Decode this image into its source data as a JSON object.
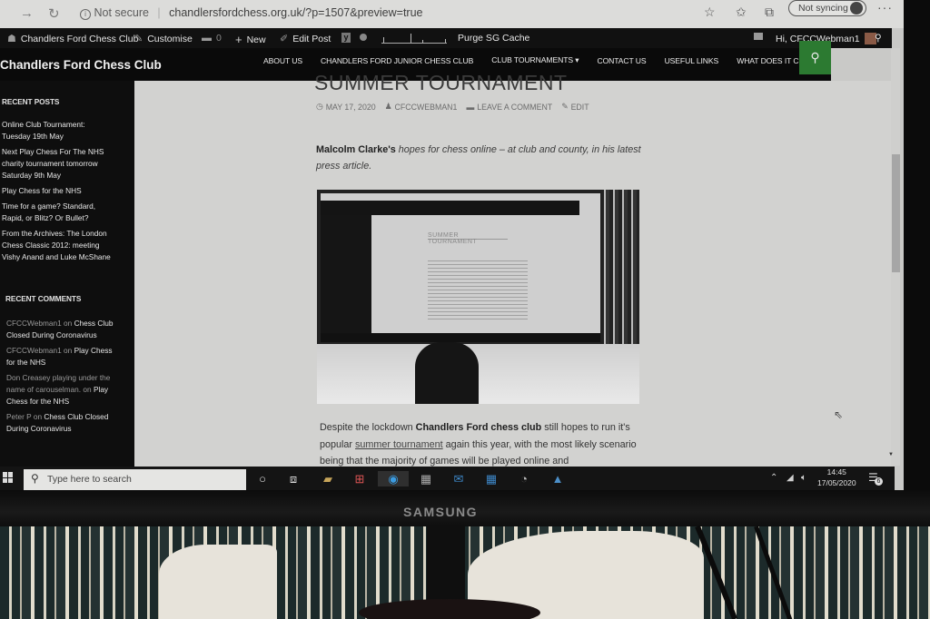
{
  "browser": {
    "back_icon": "→",
    "refresh_icon": "↻",
    "security_label": "Not secure",
    "url": "chandlersfordchess.org.uk/?p=1507&preview=true",
    "sync_label": "Not syncing",
    "more_icon": "···"
  },
  "adminbar": {
    "site_name": "Chandlers Ford Chess Club",
    "customise": "Customise",
    "comments_count": "0",
    "new": "New",
    "edit_post": "Edit Post",
    "purge_cache": "Purge SG Cache",
    "greeting": "Hi, CFCCWebman1"
  },
  "site": {
    "title": "Chandlers Ford Chess Club",
    "menu": [
      "ABOUT US",
      "CHANDLERS FORD JUNIOR CHESS CLUB",
      "CLUB TOURNAMENTS ▾",
      "CONTACT US",
      "USEFUL LINKS",
      "WHAT DOES IT COST?"
    ]
  },
  "sidebar": {
    "recent_posts_title": "RECENT POSTS",
    "recent_posts": [
      "Online Club Tournament: Tuesday 19th May",
      "Next Play Chess For The NHS charity tournament tomorrow Saturday 9th May",
      "Play Chess for the NHS",
      "Time for a game? Standard, Rapid, or Blitz? Or Bullet?",
      "From the Archives: The London Chess Classic 2012: meeting Vishy Anand and Luke McShane"
    ],
    "recent_comments_title": "RECENT COMMENTS",
    "recent_comments": [
      {
        "author": "CFCCWebman1",
        "on": " on ",
        "post": "Chess Club Closed During Coronavirus"
      },
      {
        "author": "CFCCWebman1",
        "on": " on ",
        "post": "Play Chess for the NHS"
      },
      {
        "author": "Don Creasey playing under the name of carouselman.",
        "on": " on ",
        "post": "Play Chess for the NHS"
      },
      {
        "author": "Peter P",
        "on": " on ",
        "post": "Chess Club Closed During Coronavirus"
      }
    ]
  },
  "post": {
    "title": "SUMMER TOURNAMENT",
    "date": "MAY 17, 2020",
    "author": "CFCCWEBMAN1",
    "comment_link": "LEAVE A COMMENT",
    "edit_link": "EDIT",
    "lead_bold": "Malcolm Clarke's",
    "lead_rest": " hopes for chess online – at club and county, in his latest press article.",
    "body_1": "Despite the lockdown ",
    "body_bold": "Chandlers Ford chess club",
    "body_2": " still hopes to run it's popular ",
    "body_link": "summer tournament",
    "body_3": " again this year, with the most likely scenario being that the majority of games will be played online and"
  },
  "taskbar": {
    "search_placeholder": "Type here to search",
    "time": "14:45",
    "date": "17/05/2020",
    "notifications": "6"
  },
  "monitor": {
    "brand": "SAMSUNG"
  }
}
